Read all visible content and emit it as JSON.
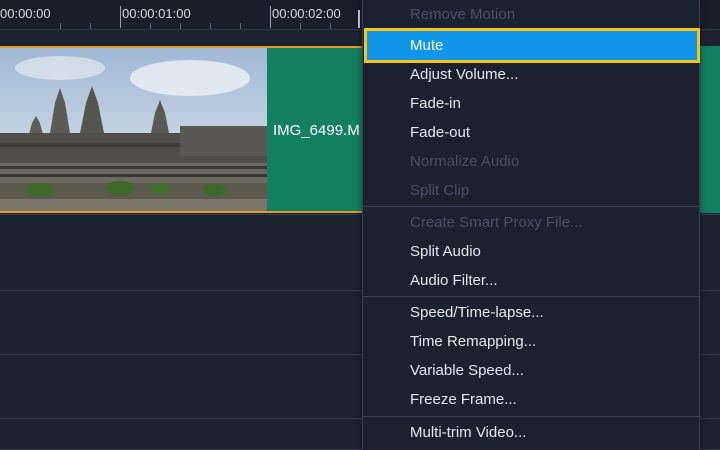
{
  "ruler": {
    "labels": [
      "00:00:00",
      "00:00:01:00",
      "00:00:02:00"
    ]
  },
  "clip": {
    "name": "IMG_6499.M"
  },
  "context_menu": {
    "items": [
      {
        "label": "Remove Motion",
        "enabled": false
      },
      {
        "label": "Mute",
        "enabled": true,
        "selected": true
      },
      {
        "label": "Adjust Volume...",
        "enabled": true
      },
      {
        "label": "Fade-in",
        "enabled": true
      },
      {
        "label": "Fade-out",
        "enabled": true
      },
      {
        "label": "Normalize Audio",
        "enabled": false
      },
      {
        "label": "Split Clip",
        "enabled": false
      },
      {
        "label": "Create Smart Proxy File...",
        "enabled": false
      },
      {
        "label": "Split Audio",
        "enabled": true
      },
      {
        "label": "Audio Filter...",
        "enabled": true
      },
      {
        "label": "Speed/Time-lapse...",
        "enabled": true
      },
      {
        "label": "Time Remapping...",
        "enabled": true
      },
      {
        "label": "Variable Speed...",
        "enabled": true
      },
      {
        "label": "Freeze Frame...",
        "enabled": true
      },
      {
        "label": "Multi-trim Video...",
        "enabled": true
      }
    ]
  },
  "colors": {
    "clip_green": "#13805f",
    "clip_border": "#e49a2a",
    "highlight_blue": "#0f96e8",
    "highlight_outline": "#f5c416",
    "background": "#1e2331"
  }
}
